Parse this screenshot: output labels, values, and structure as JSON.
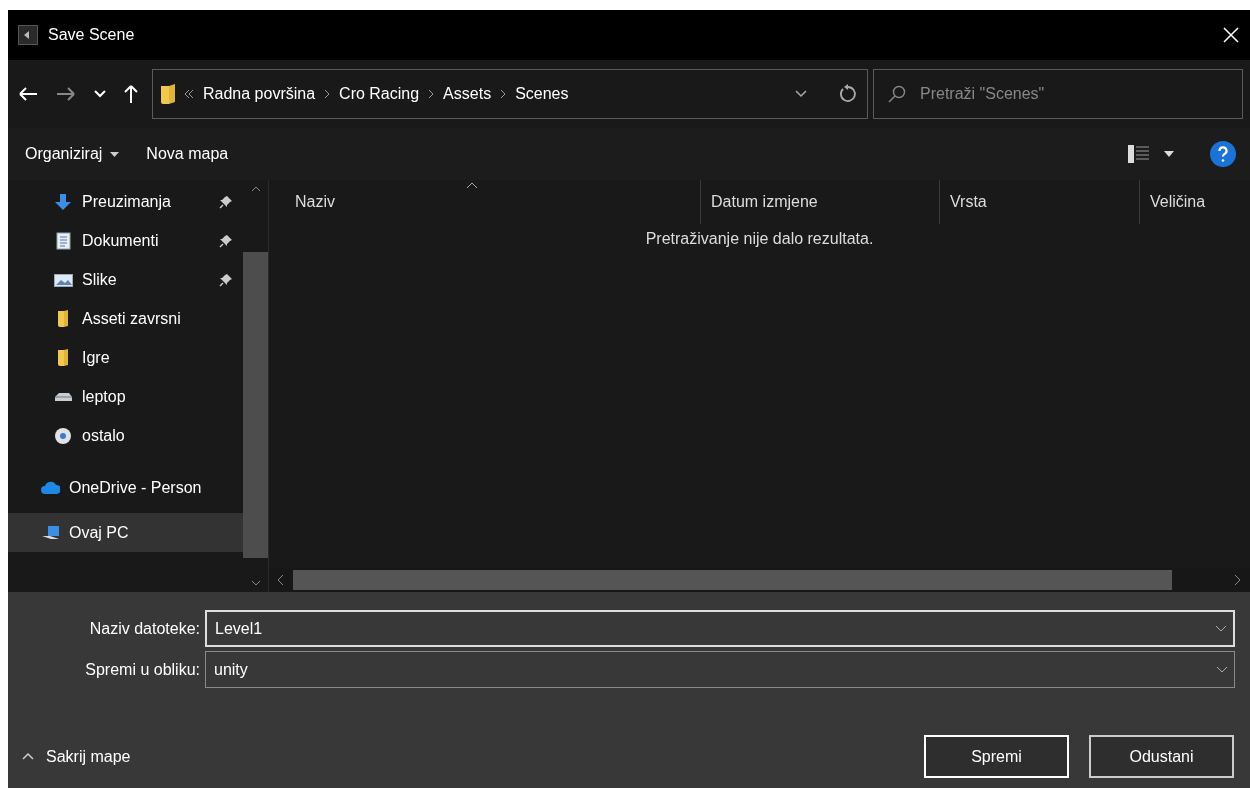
{
  "window": {
    "title": "Save Scene"
  },
  "address": {
    "segments": [
      "Radna površina",
      "Cro Racing",
      "Assets",
      "Scenes"
    ]
  },
  "search": {
    "placeholder": "Pretraži \"Scenes\""
  },
  "toolbar": {
    "organize": "Organiziraj",
    "new_folder": "Nova mapa"
  },
  "sidebar": {
    "items": [
      {
        "label": "Preuzimanja",
        "kind": "download",
        "pinned": true,
        "selected": false
      },
      {
        "label": "Dokumenti",
        "kind": "document",
        "pinned": true,
        "selected": false
      },
      {
        "label": "Slike",
        "kind": "picture",
        "pinned": true,
        "selected": false
      },
      {
        "label": "Asseti zavrsni",
        "kind": "folder",
        "pinned": false,
        "selected": false
      },
      {
        "label": "Igre",
        "kind": "folder",
        "pinned": false,
        "selected": false
      },
      {
        "label": "leptop",
        "kind": "drive",
        "pinned": false,
        "selected": false
      },
      {
        "label": "ostalo",
        "kind": "disc",
        "pinned": false,
        "selected": false
      },
      {
        "label": "OneDrive - Person",
        "kind": "cloud",
        "pinned": false,
        "selected": false
      },
      {
        "label": "Ovaj PC",
        "kind": "computer",
        "pinned": false,
        "selected": true
      }
    ]
  },
  "table": {
    "columns": [
      {
        "label": "Naziv",
        "sorted": true
      },
      {
        "label": "Datum izmjene",
        "sorted": false
      },
      {
        "label": "Vrsta",
        "sorted": false
      },
      {
        "label": "Veličina",
        "sorted": false
      }
    ],
    "empty_message": "Pretraživanje nije dalo rezultata."
  },
  "form": {
    "filename_label": "Naziv datoteke:",
    "filename": "Level1",
    "type_label": "Spremi u obliku:",
    "type": "unity"
  },
  "footer": {
    "hide_folders": "Sakrij mape",
    "buttons": [
      "Spremi",
      "Odustani"
    ]
  }
}
